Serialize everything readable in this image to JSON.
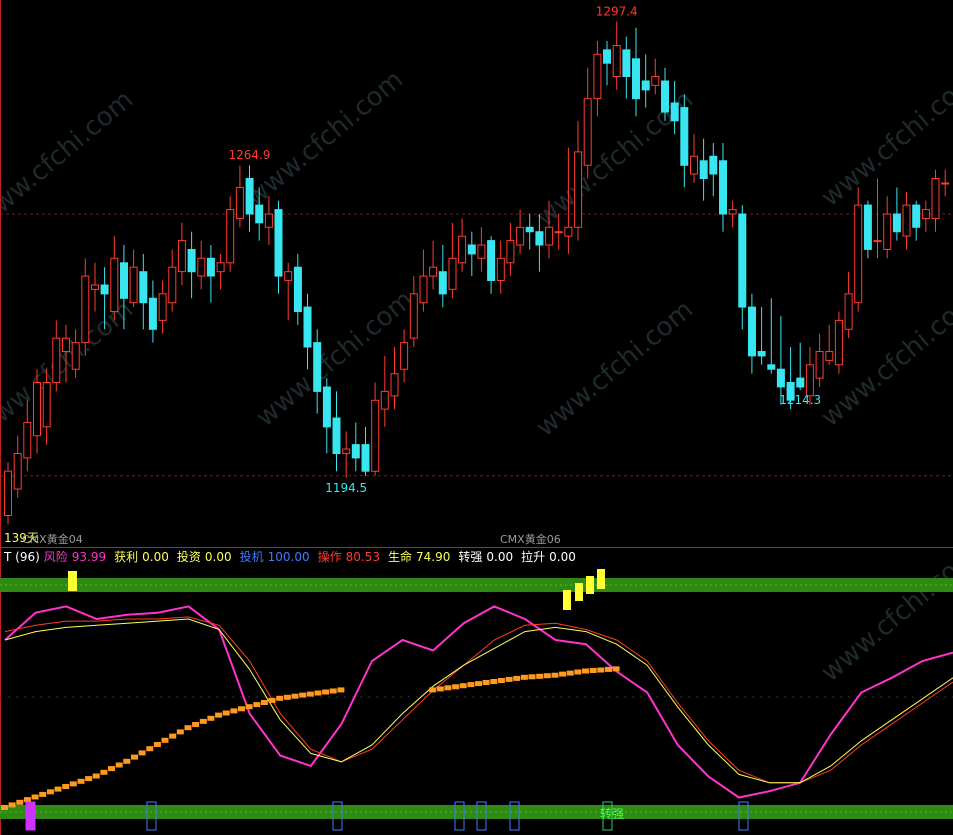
{
  "chart_data": [
    {
      "type": "candlestick",
      "name": "price",
      "colors": {
        "up": "#ff3b30",
        "down": "#37e6f0",
        "dash": "#ff3b30"
      },
      "annotations": [
        {
          "text": "1297.4",
          "color": "#ff3b30",
          "at": "high",
          "candle": 63
        },
        {
          "text": "1264.9",
          "color": "#ff3b30",
          "at": "high",
          "candle": 25
        },
        {
          "text": "1194.5",
          "color": "#37e6f0",
          "at": "low",
          "candle": 35
        },
        {
          "text": "1214.3",
          "color": "#37e6f0",
          "at": "low",
          "candle": 82
        }
      ],
      "date_labels": [
        "CMX黄金04",
        "CMX黄金06"
      ],
      "days_label": "139天",
      "yrange": [
        1185,
        1300
      ],
      "candles": [
        [
          1186,
          1196,
          1184,
          1198
        ],
        [
          1192,
          1200,
          1190,
          1204
        ],
        [
          1199,
          1207,
          1196,
          1212
        ],
        [
          1204,
          1216,
          1200,
          1219
        ],
        [
          1206,
          1216,
          1202,
          1219
        ],
        [
          1216,
          1226,
          1214,
          1230
        ],
        [
          1223,
          1226,
          1216,
          1229
        ],
        [
          1219,
          1225,
          1217,
          1228
        ],
        [
          1225,
          1240,
          1222,
          1244
        ],
        [
          1237,
          1238,
          1232,
          1243
        ],
        [
          1238,
          1236,
          1228,
          1242
        ],
        [
          1232,
          1244,
          1230,
          1249
        ],
        [
          1243,
          1235,
          1228,
          1247
        ],
        [
          1234,
          1242,
          1233,
          1246
        ],
        [
          1241,
          1234,
          1228,
          1245
        ],
        [
          1235,
          1228,
          1225,
          1239
        ],
        [
          1230,
          1236,
          1227,
          1239
        ],
        [
          1234,
          1242,
          1232,
          1246
        ],
        [
          1241,
          1248,
          1238,
          1252
        ],
        [
          1246,
          1241,
          1235,
          1250
        ],
        [
          1240,
          1244,
          1237,
          1248
        ],
        [
          1244,
          1240,
          1234,
          1247
        ],
        [
          1241,
          1243,
          1237,
          1245
        ],
        [
          1243,
          1255,
          1241,
          1258
        ],
        [
          1253,
          1260,
          1251,
          1264.9
        ],
        [
          1262,
          1254,
          1250,
          1265
        ],
        [
          1256,
          1252,
          1248,
          1260
        ],
        [
          1251,
          1254,
          1247,
          1258
        ],
        [
          1255,
          1240,
          1236,
          1257
        ],
        [
          1239,
          1241,
          1230,
          1243
        ],
        [
          1242,
          1232,
          1229,
          1245
        ],
        [
          1233,
          1224,
          1219,
          1236
        ],
        [
          1225,
          1214,
          1209,
          1228
        ],
        [
          1215,
          1206,
          1200,
          1217
        ],
        [
          1208,
          1200,
          1196,
          1214
        ],
        [
          1200,
          1201,
          1194.5,
          1205
        ],
        [
          1202,
          1199,
          1196,
          1207
        ],
        [
          1202,
          1196,
          1195,
          1206
        ],
        [
          1196,
          1212,
          1195,
          1216
        ],
        [
          1210,
          1214,
          1206,
          1222
        ],
        [
          1213,
          1218,
          1210,
          1224
        ],
        [
          1219,
          1225,
          1216,
          1228
        ],
        [
          1226,
          1236,
          1224,
          1240
        ],
        [
          1234,
          1240,
          1232,
          1246
        ],
        [
          1240,
          1242,
          1237,
          1248
        ],
        [
          1241,
          1236,
          1233,
          1247
        ],
        [
          1237,
          1244,
          1235,
          1252
        ],
        [
          1243,
          1249,
          1241,
          1253
        ],
        [
          1247,
          1245,
          1240,
          1250
        ],
        [
          1244,
          1247,
          1241,
          1251
        ],
        [
          1248,
          1239,
          1236,
          1249
        ],
        [
          1239,
          1244,
          1236,
          1248
        ],
        [
          1243,
          1248,
          1240,
          1252
        ],
        [
          1247,
          1251,
          1245,
          1255
        ],
        [
          1251,
          1250,
          1246,
          1254
        ],
        [
          1250,
          1247,
          1241,
          1254
        ],
        [
          1247,
          1251,
          1244,
          1257
        ],
        [
          1250,
          1250,
          1246,
          1254
        ],
        [
          1249,
          1251,
          1245,
          1269
        ],
        [
          1251,
          1268,
          1248,
          1275
        ],
        [
          1265,
          1280,
          1262,
          1287
        ],
        [
          1280,
          1290,
          1276,
          1293
        ],
        [
          1291,
          1288,
          1283,
          1293
        ],
        [
          1285,
          1292,
          1282,
          1297.4
        ],
        [
          1291,
          1285,
          1280,
          1294
        ],
        [
          1289,
          1280,
          1276,
          1296
        ],
        [
          1284,
          1282,
          1278,
          1290
        ],
        [
          1283,
          1285,
          1281,
          1289
        ],
        [
          1284,
          1277,
          1275,
          1287
        ],
        [
          1279,
          1275,
          1272,
          1284
        ],
        [
          1278,
          1265,
          1260,
          1281
        ],
        [
          1263,
          1267,
          1261,
          1272
        ],
        [
          1266,
          1262,
          1257,
          1271
        ],
        [
          1267,
          1263,
          1258,
          1270
        ],
        [
          1266,
          1254,
          1250,
          1270
        ],
        [
          1254,
          1255,
          1251,
          1257
        ],
        [
          1254,
          1233,
          1228,
          1256
        ],
        [
          1233,
          1222,
          1218,
          1236
        ],
        [
          1223,
          1222,
          1220,
          1233
        ],
        [
          1220,
          1219,
          1218,
          1235
        ],
        [
          1219,
          1215,
          1211,
          1231
        ],
        [
          1216,
          1212,
          1210,
          1224
        ],
        [
          1217,
          1215,
          1214.3,
          1225
        ],
        [
          1213,
          1220,
          1211,
          1224
        ],
        [
          1217,
          1223,
          1215,
          1227
        ],
        [
          1221,
          1223,
          1220,
          1229
        ],
        [
          1220,
          1230,
          1218,
          1232
        ],
        [
          1228,
          1236,
          1226,
          1241
        ],
        [
          1234,
          1256,
          1232,
          1260
        ],
        [
          1256,
          1246,
          1244,
          1257
        ],
        [
          1248,
          1248,
          1244,
          1262
        ],
        [
          1246,
          1254,
          1244,
          1258
        ],
        [
          1254,
          1250,
          1248,
          1260
        ],
        [
          1249,
          1256,
          1246,
          1259
        ],
        [
          1256,
          1251,
          1248,
          1257
        ],
        [
          1253,
          1255,
          1250,
          1257
        ],
        [
          1253,
          1262,
          1250,
          1264
        ],
        [
          1261,
          1261,
          1258,
          1264
        ]
      ]
    },
    {
      "type": "line",
      "name": "indicator",
      "title": "T (96)",
      "legend": [
        {
          "name": "风险",
          "value": "93.99",
          "color": "#ff33cc"
        },
        {
          "name": "获利",
          "value": "0.00",
          "color": "#ffff55"
        },
        {
          "name": "投资",
          "value": "0.00",
          "color": "#ffff55"
        },
        {
          "name": "投机",
          "value": "100.00",
          "color": "#3d7bff"
        },
        {
          "name": "操作",
          "value": "80.53",
          "color": "#ff3b30"
        },
        {
          "name": "生命",
          "value": "74.90",
          "color": "#ffff55"
        },
        {
          "name": "转强",
          "value": "0.00",
          "color": "#ffffff"
        },
        {
          "name": "拉升",
          "value": "0.00",
          "color": "#ffffff"
        }
      ],
      "yrange": [
        0,
        100
      ],
      "x": [
        0,
        5,
        10,
        15,
        20,
        25,
        30,
        35,
        40,
        45,
        50,
        55,
        60,
        65,
        70,
        75,
        80,
        85,
        90,
        95,
        100
      ],
      "series": [
        {
          "name": "风险",
          "color": "#ff33cc",
          "values": [
            80,
            93,
            96,
            90,
            92,
            93,
            96,
            85,
            45,
            25,
            20,
            40,
            70,
            80,
            75,
            88,
            96,
            90,
            80,
            78,
            65,
            55,
            30,
            15,
            5,
            8,
            12,
            35,
            55,
            62,
            70,
            74
          ]
        },
        {
          "name": "操作",
          "color": "#ff3b30",
          "values": [
            84,
            87,
            89,
            89,
            90,
            90,
            91,
            87,
            70,
            45,
            28,
            22,
            28,
            42,
            56,
            68,
            80,
            87,
            88,
            85,
            80,
            70,
            50,
            32,
            18,
            12,
            12,
            18,
            30,
            40,
            50,
            60
          ]
        },
        {
          "name": "生命",
          "color": "#ffff55",
          "values": [
            80,
            84,
            86,
            87,
            88,
            89,
            90,
            85,
            66,
            42,
            26,
            22,
            30,
            45,
            58,
            68,
            76,
            84,
            86,
            84,
            78,
            68,
            48,
            30,
            16,
            12,
            12,
            20,
            32,
            42,
            52,
            62
          ]
        },
        {
          "name": "orange",
          "color": "#ff9a1e",
          "dashed": true,
          "values": [
            0,
            5,
            10,
            15,
            22,
            30,
            38,
            44,
            48,
            52,
            54,
            56,
            null,
            null,
            56,
            58,
            60,
            62,
            63,
            65,
            66,
            null,
            null,
            null,
            null,
            null,
            null,
            null,
            null,
            null,
            null,
            null
          ]
        }
      ],
      "markers": {
        "bottom_label": "转强",
        "bottom_label_color": "#44ff44"
      }
    }
  ]
}
